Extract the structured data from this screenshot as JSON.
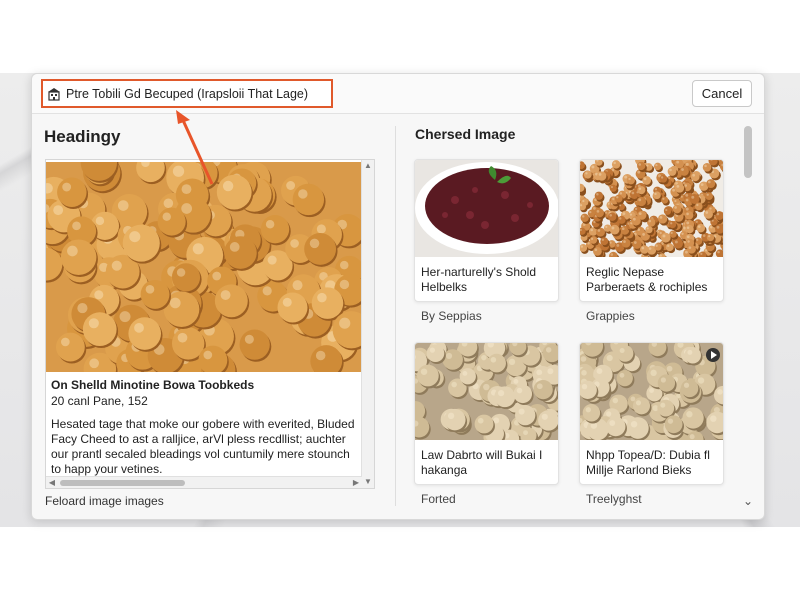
{
  "dialog": {
    "title": "Ptre Tobili Gd Becuped (Irapsloii That Lage)",
    "cancel_label": "Cancel"
  },
  "left_panel": {
    "heading": "Headingy",
    "preview_title": "On Shelld Minotine Bowa Toobkeds",
    "preview_subtitle": "20 canl Pane, 152",
    "preview_description": "Hesated tage that moke our gobere with everited, Bluded Facy Cheed to ast a ralljice, arVl pless recdllist; auchter our prantl secaled bleadings vol cuntumily mere stounch to happ your vetines.",
    "footer_link": "Feloard image images"
  },
  "right_panel": {
    "heading": "Chersed Image",
    "cards": [
      {
        "caption": "Her-narturelly's Shold Helbelks",
        "label": "By Seppias",
        "image": "red-lentil-bowl"
      },
      {
        "caption": "Reglic Nepase Parberaets & rochiples",
        "label": "Grappies",
        "image": "lentil-bowl"
      },
      {
        "caption": "Law Dabrto will Bukai I hakanga",
        "label": "Forted",
        "image": "chickpeas"
      },
      {
        "caption": "Nhpp Topea/D: Dubia fl Millje Rarlond Bieks",
        "label": "Treelyghst",
        "image": "chickpeas-video"
      }
    ]
  },
  "colors": {
    "highlight_border": "#e0592b",
    "arrow": "#e8552a"
  }
}
